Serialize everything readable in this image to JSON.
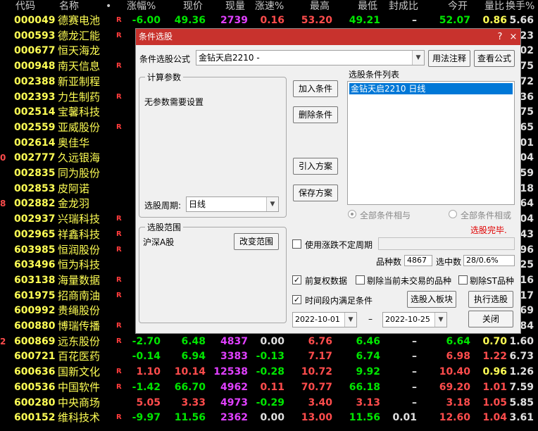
{
  "columns": {
    "code": "代码",
    "name": "名称",
    "dot": "•",
    "pct": "涨幅%",
    "price": "现价",
    "vol": "现量",
    "speed": "涨速%",
    "high": "最高",
    "low": "最低",
    "fengcheng": "封成比",
    "open": "今开",
    "liangbi": "量比",
    "turnover": "换手%"
  },
  "rows": [
    {
      "code": "000049",
      "name": "德赛电池",
      "flag": "R",
      "edge": "",
      "pct": "-6.00",
      "price": "49.36",
      "vol": "2739",
      "speed": "0.16",
      "high": "53.20",
      "low": "49.21",
      "fc": "–",
      "open": "52.07",
      "lb": "0.86",
      "to": "5.66",
      "pc": "green",
      "prc": "green",
      "vc": "mag",
      "sc": "red",
      "hc": "red",
      "lc": "green",
      "oc": "green",
      "lbc": "yel",
      "toc": "wht"
    },
    {
      "code": "000593",
      "name": "德龙汇能",
      "flag": "R",
      "edge": "",
      "to": "23"
    },
    {
      "code": "000677",
      "name": "恒天海龙",
      "flag": "",
      "edge": "",
      "to": "02"
    },
    {
      "code": "000948",
      "name": "南天信息",
      "flag": "R",
      "edge": "",
      "to": "75"
    },
    {
      "code": "002388",
      "name": "新亚制程",
      "flag": "",
      "edge": "",
      "to": "72"
    },
    {
      "code": "002393",
      "name": "力生制药",
      "flag": "R",
      "edge": "",
      "to": "36"
    },
    {
      "code": "002514",
      "name": "宝馨科技",
      "flag": "",
      "edge": "",
      "to": "75"
    },
    {
      "code": "002559",
      "name": "亚威股份",
      "flag": "R",
      "edge": "",
      "to": "65"
    },
    {
      "code": "002614",
      "name": "奥佳华",
      "flag": "",
      "edge": "",
      "to": "01"
    },
    {
      "code": "002777",
      "name": "久远银海",
      "flag": "",
      "edge": "0",
      "to": "04"
    },
    {
      "code": "002835",
      "name": "同为股份",
      "flag": "",
      "edge": "",
      "to": "59"
    },
    {
      "code": "002853",
      "name": "皮阿诺",
      "flag": "",
      "edge": "",
      "to": "18"
    },
    {
      "code": "002882",
      "name": "金龙羽",
      "flag": "",
      "edge": "8",
      "to": "64"
    },
    {
      "code": "002937",
      "name": "兴瑞科技",
      "flag": "R",
      "edge": "",
      "to": "04"
    },
    {
      "code": "002965",
      "name": "祥鑫科技",
      "flag": "R",
      "edge": "",
      "to": "43"
    },
    {
      "code": "603985",
      "name": "恒润股份",
      "flag": "R",
      "edge": "",
      "to": "96"
    },
    {
      "code": "603496",
      "name": "恒为科技",
      "flag": "",
      "edge": "",
      "to": "25"
    },
    {
      "code": "603138",
      "name": "海量数据",
      "flag": "R",
      "edge": "",
      "to": "16"
    },
    {
      "code": "601975",
      "name": "招商南油",
      "flag": "R",
      "edge": "",
      "to": "17"
    },
    {
      "code": "600992",
      "name": "贵绳股份",
      "flag": "",
      "edge": "",
      "to": "69"
    },
    {
      "code": "600880",
      "name": "博瑞传播",
      "flag": "R",
      "edge": "",
      "to": "84"
    },
    {
      "code": "600869",
      "name": "远东股份",
      "flag": "R",
      "edge": "2",
      "pct": "-2.70",
      "price": "6.48",
      "vol": "4837",
      "speed": "0.00",
      "high": "6.76",
      "low": "6.46",
      "fc": "–",
      "open": "6.64",
      "lb": "0.70",
      "to": "1.60",
      "pc": "green",
      "prc": "green",
      "vc": "mag",
      "sc": "wht",
      "hc": "red",
      "lc": "green",
      "oc": "green",
      "lbc": "yel",
      "toc": "wht"
    },
    {
      "code": "600721",
      "name": "百花医药",
      "flag": "",
      "edge": "",
      "pct": "-0.14",
      "price": "6.94",
      "vol": "3383",
      "speed": "-0.13",
      "high": "7.17",
      "low": "6.74",
      "fc": "–",
      "open": "6.98",
      "lb": "1.22",
      "to": "6.73",
      "pc": "green",
      "prc": "green",
      "vc": "mag",
      "sc": "green",
      "hc": "red",
      "lc": "green",
      "oc": "red",
      "lbc": "red",
      "toc": "wht"
    },
    {
      "code": "600636",
      "name": "国新文化",
      "flag": "R",
      "edge": "",
      "pct": "1.10",
      "price": "10.14",
      "vol": "12538",
      "speed": "-0.28",
      "high": "10.72",
      "low": "9.92",
      "fc": "–",
      "open": "10.40",
      "lb": "0.96",
      "to": "1.26",
      "pc": "red",
      "prc": "red",
      "vc": "mag",
      "sc": "green",
      "hc": "red",
      "lc": "green",
      "oc": "red",
      "lbc": "yel",
      "toc": "wht"
    },
    {
      "code": "600536",
      "name": "中国软件",
      "flag": "R",
      "edge": "",
      "pct": "-1.42",
      "price": "66.70",
      "vol": "4962",
      "speed": "0.11",
      "high": "70.77",
      "low": "66.18",
      "fc": "–",
      "open": "69.20",
      "lb": "1.01",
      "to": "7.59",
      "pc": "green",
      "prc": "green",
      "vc": "mag",
      "sc": "red",
      "hc": "red",
      "lc": "green",
      "oc": "red",
      "lbc": "red",
      "toc": "wht"
    },
    {
      "code": "600280",
      "name": "中央商场",
      "flag": "",
      "edge": "",
      "pct": "5.05",
      "price": "3.33",
      "vol": "4973",
      "speed": "-0.29",
      "high": "3.40",
      "low": "3.13",
      "fc": "–",
      "open": "3.18",
      "lb": "1.05",
      "to": "5.85",
      "pc": "red",
      "prc": "red",
      "vc": "mag",
      "sc": "green",
      "hc": "red",
      "lc": "red",
      "oc": "red",
      "lbc": "red",
      "toc": "wht"
    },
    {
      "code": "600152",
      "name": "维科技术",
      "flag": "R",
      "edge": "",
      "pct": "-9.97",
      "price": "11.56",
      "vol": "2362",
      "speed": "0.00",
      "high": "13.00",
      "low": "11.56",
      "fc": "0.01",
      "open": "12.60",
      "lb": "1.04",
      "to": "3.61",
      "pc": "green",
      "prc": "green",
      "vc": "mag",
      "sc": "wht",
      "hc": "red",
      "lc": "green",
      "oc": "red",
      "lbc": "red",
      "toc": "wht"
    }
  ],
  "dialog": {
    "title": "条件选股",
    "help_icon": "?",
    "close_icon": "×",
    "formula_label": "条件选股公式",
    "formula_value": "金钻天启2210  -",
    "usage_button": "用法注释",
    "view_formula_button": "查看公式",
    "params_group": "计算参数",
    "params_text": "无参数需要设置",
    "period_label": "选股周期:",
    "period_value": "日线",
    "add_button": "加入条件",
    "delete_button": "删除条件",
    "import_button": "引入方案",
    "save_button": "保存方案",
    "list_label": "选股条件列表",
    "list_item": "金钻天启2210   日线",
    "radio_and": "全部条件相与",
    "radio_or": "全部条件相或",
    "status": "选股完毕.",
    "scope_group": "选股范围",
    "scope_value": "沪深A股",
    "scope_button": "改变范围",
    "uncertain_label": "使用涨跌不定周期",
    "count_label": "品种数",
    "count_value": "4867",
    "selected_label": "选中数",
    "selected_value": "28/0.6%",
    "adjust_label": "前复权数据",
    "exclude_notrade_label": "剔除当前未交易的品种",
    "exclude_st_label": "剔除ST品种",
    "timerange_label": "时间段内满足条件",
    "to_block_button": "选股入板块",
    "run_button": "执行选股",
    "date_from": "2022-10-01",
    "date_sep": "–",
    "date_to": "2022-10-25",
    "close_button": "关闭"
  },
  "colors": {
    "title_bar": "#c8322d",
    "stock_code": "#ffff55",
    "up": "#ff4c4c",
    "down": "#00e600",
    "volume": "#e040ff",
    "status_text": "#e00000"
  }
}
